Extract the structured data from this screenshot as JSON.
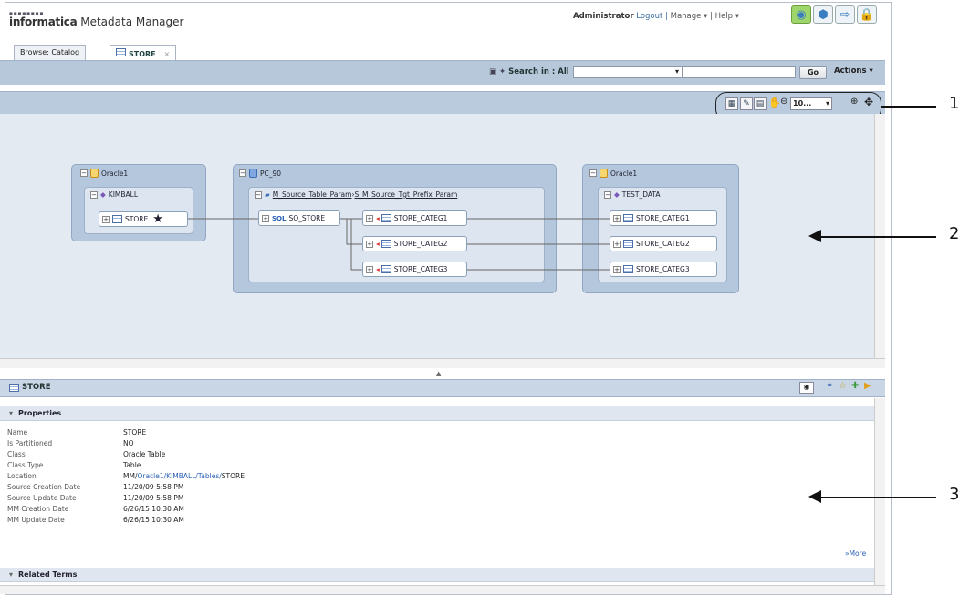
{
  "app": {
    "logo_brand": "informatica",
    "logo_product": "Metadata Manager"
  },
  "header": {
    "user": "Administrator",
    "logout": "Logout |",
    "manage": "Manage ▾ |",
    "help": "Help ▾"
  },
  "tabs": [
    {
      "label": "Browse: Catalog"
    },
    {
      "label": "STORE",
      "close": "×"
    }
  ],
  "search": {
    "label": "Search in : All",
    "go": "Go",
    "actions": "Actions ▾"
  },
  "lineage": {
    "zoom": "10...",
    "groups": [
      {
        "name": "Oracle1",
        "schema": "KIMBALL",
        "nodes": [
          "STORE"
        ]
      },
      {
        "name": "PC_90",
        "mapping": "M_Source_Table_Param",
        "separator": " › ",
        "session": "S_M_Source_Tgt_Prefix_Param",
        "source": "SQ_STORE",
        "nodes": [
          "STORE_CATEG1",
          "STORE_CATEG2",
          "STORE_CATEG3"
        ]
      },
      {
        "name": "Oracle1",
        "schema": "TEST_DATA",
        "nodes": [
          "STORE_CATEG1",
          "STORE_CATEG2",
          "STORE_CATEG3"
        ]
      }
    ],
    "star": "★"
  },
  "details": {
    "title": "STORE",
    "properties_header": "Properties",
    "properties": [
      {
        "key": "Name",
        "value": "STORE"
      },
      {
        "key": "Is Partitioned",
        "value": "NO"
      },
      {
        "key": "Class",
        "value": "Oracle Table"
      },
      {
        "key": "Class Type",
        "value": "Table"
      },
      {
        "key": "Location",
        "value_prefix": "MM/",
        "value_links": "Oracle1/KIMBALL/Tables/",
        "value_suffix": "STORE"
      },
      {
        "key": "Source Creation Date",
        "value": "11/20/09 5:58 PM"
      },
      {
        "key": "Source Update Date",
        "value": "11/20/09 5:58 PM"
      },
      {
        "key": "MM Creation Date",
        "value": "6/26/15 10:30 AM"
      },
      {
        "key": "MM Update Date",
        "value": "6/26/15 10:30 AM"
      }
    ],
    "more": "»More",
    "related_header": "Related Terms"
  },
  "callouts": [
    "1",
    "2",
    "3"
  ],
  "colors": {
    "accent": "#3a7dc0",
    "active_icon": "#9fd66b",
    "group_bg": "#b5c7dc",
    "canvas_bg": "#e3eaf2"
  }
}
